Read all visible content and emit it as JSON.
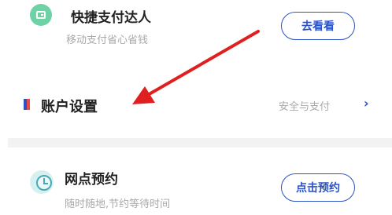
{
  "quick_pay": {
    "title": "快捷支付达人",
    "subtitle": "移动支付省心省钱",
    "button_label": "去看看",
    "icon": "wallet-icon",
    "icon_color": "#6fd1a6"
  },
  "account_settings": {
    "title": "账户设置",
    "right_text": "安全与支付",
    "chevron": "›",
    "icon": "flag-icon",
    "flag_colors": [
      "#2a52c4",
      "#e84a4a"
    ]
  },
  "branch_booking": {
    "title": "网点预约",
    "subtitle": "随时随地,节约等待时间",
    "button_label": "点击预约",
    "icon": "alarm-clock-icon",
    "icon_color": "#4aa8b7"
  },
  "annotation": {
    "icon": "red-arrow-annotation",
    "color": "#e02020"
  },
  "colors": {
    "accent": "#2a52c4",
    "muted_text": "#a9a9a9",
    "divider": "#f2f2f2"
  }
}
